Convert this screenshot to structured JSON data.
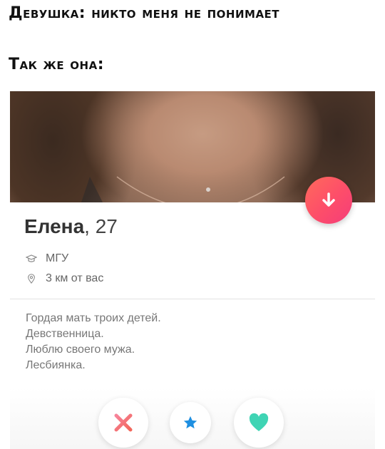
{
  "meme": {
    "caption_top": "Девушка: никто меня не понимает",
    "caption_bottom": "Так же она:"
  },
  "profile": {
    "name": "Елена",
    "age_text": ", 27",
    "school": "МГУ",
    "distance": "3 км от вас",
    "bio": [
      "Гордая мать троих детей.",
      "Девственница.",
      "Люблю своего мужа.",
      "Лесбиянка."
    ]
  },
  "icons": {
    "school": "graduation-cap-icon",
    "distance": "location-pin-icon",
    "info_toggle": "arrow-down-icon",
    "nope": "x-icon",
    "superlike": "star-icon",
    "like": "heart-icon"
  },
  "colors": {
    "accent_gradient_start": "#ff6a5b",
    "accent_gradient_end": "#f43d7a",
    "nope_color": "#f46b6b",
    "superlike_color": "#1e8fe1",
    "like_color": "#3fd4b4"
  }
}
